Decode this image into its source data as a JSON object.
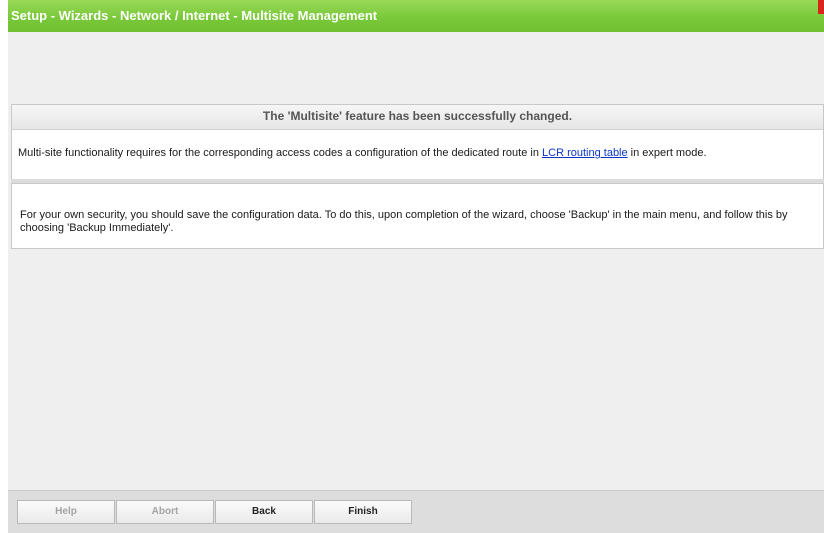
{
  "header": {
    "title": "Setup - Wizards - Network / Internet - Multisite Management",
    "close_icon": "close-icon",
    "accent": "#7ac93b"
  },
  "status_panel": {
    "message": "The 'Multisite' feature has been successfully changed.",
    "body_before": "Multi-site functionality requires for the corresponding access codes a configuration of the dedicated route in ",
    "link_text": "LCR routing table",
    "body_after": " in expert mode."
  },
  "security_panel": {
    "text": "For your own security, you should save the configuration data. To do this, upon completion of the wizard, choose 'Backup' in the main menu, and follow this by choosing 'Backup Immediately'."
  },
  "footer": {
    "help_label": "Help",
    "abort_label": "Abort",
    "back_label": "Back",
    "finish_label": "Finish"
  }
}
